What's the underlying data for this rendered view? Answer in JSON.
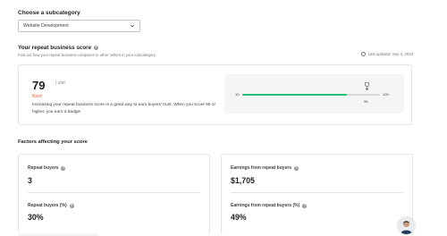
{
  "subcategory": {
    "heading": "Choose a subcategory",
    "selected": "Website Development"
  },
  "repeat_score": {
    "title": "Your repeat business score",
    "description": "Find out how your repeat business compares to other sellers in your subcategory.",
    "last_updated": "Last updated: Sep 3, 2023",
    "score": "79",
    "max": "/ 100",
    "rating": "Nice!",
    "explanation": "Increasing your repeat business score is a great way to earn buyers' trust. When you score 95 or higher, you earn a badge!",
    "gauge": {
      "min_label": "10",
      "max_label": "100",
      "target_label": "95",
      "fill_fraction": 0.76
    }
  },
  "factors": {
    "title": "Factors affecting your score",
    "left": [
      {
        "label": "Repeat buyers",
        "value": "3"
      },
      {
        "label": "Repeat buyers (%)",
        "value": "30%"
      }
    ],
    "right": [
      {
        "label": "Earnings from repeat buyers",
        "value": "$1,705"
      },
      {
        "label": "Earnings from repeat buyers (%)",
        "value": "49%"
      }
    ]
  },
  "colors": {
    "accent_green": "#1dbf73",
    "nice_orange": "#e5683b"
  },
  "icons": [
    "chevron-down-icon",
    "info-icon",
    "clock-icon",
    "trophy-icon",
    "avatar"
  ]
}
